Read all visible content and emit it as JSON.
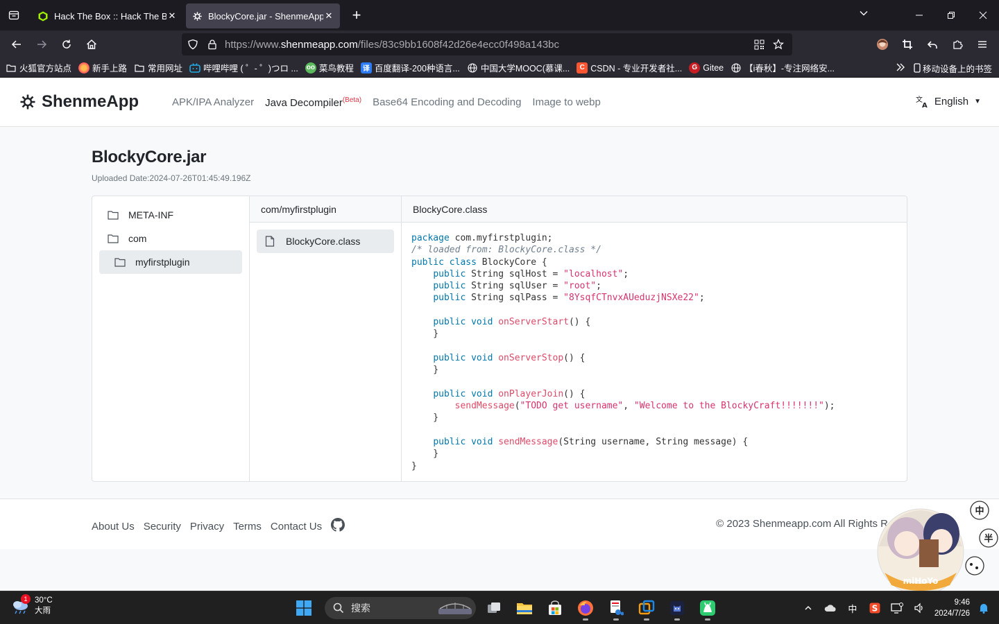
{
  "browser": {
    "tabs": [
      {
        "label": "Hack The Box :: Hack The Box",
        "active": false
      },
      {
        "label": "BlockyCore.jar - ShenmeApp",
        "active": true
      }
    ],
    "url_prefix": "https://www.",
    "url_domain": "shenmeapp.com",
    "url_path": "/files/83c9bb1608f42d26e4ecc0f498a143bc",
    "bookmarks": [
      {
        "label": "火狐官方站点",
        "icon": "folder-icon"
      },
      {
        "label": "新手上路",
        "icon": "firefox-icon"
      },
      {
        "label": "常用网址",
        "icon": "folder-icon"
      },
      {
        "label": "哔哩哔哩 ( ゜- ゜)つロ ...",
        "icon": "bilibili-icon"
      },
      {
        "label": "菜鸟教程",
        "icon": "runoob-icon"
      },
      {
        "label": "百度翻译-200种语言...",
        "icon": "translate-icon"
      },
      {
        "label": "中国大学MOOC(慕课...",
        "icon": "globe-icon"
      },
      {
        "label": "CSDN - 专业开发者社...",
        "icon": "csdn-icon"
      },
      {
        "label": "Gitee",
        "icon": "gitee-icon"
      },
      {
        "label": "【i春秋】-专注网络安...",
        "icon": "globe-icon"
      }
    ],
    "mobile_bookmarks": "移动设备上的书签"
  },
  "site": {
    "brand": "ShenmeApp",
    "nav": [
      {
        "label": "APK/IPA Analyzer",
        "active": false
      },
      {
        "label": "Java Decompiler",
        "badge": "(Beta)",
        "active": true
      },
      {
        "label": "Base64 Encoding and Decoding",
        "active": false
      },
      {
        "label": "Image to webp",
        "active": false
      }
    ],
    "language": "English"
  },
  "file": {
    "title": "BlockyCore.jar",
    "uploaded": "Uploaded Date:2024-07-26T01:45:49.196Z"
  },
  "explorer": {
    "tree": [
      {
        "label": "META-INF",
        "indent": false,
        "selected": false
      },
      {
        "label": "com",
        "indent": false,
        "selected": false
      },
      {
        "label": "myfirstplugin",
        "indent": true,
        "selected": true
      }
    ],
    "package_header": "com/myfirstplugin",
    "files": [
      "BlockyCore.class"
    ],
    "code_header": "BlockyCore.class",
    "code_lines": [
      [
        [
          "kw",
          "package"
        ],
        [
          "t",
          " com.myfirstplugin;"
        ]
      ],
      [
        [
          "cm",
          "/* loaded from: BlockyCore.class */"
        ]
      ],
      [
        [
          "kw",
          "public class"
        ],
        [
          "t",
          " BlockyCore {"
        ]
      ],
      [
        [
          "t",
          "    "
        ],
        [
          "kw",
          "public"
        ],
        [
          "t",
          " String sqlHost = "
        ],
        [
          "str",
          "\"localhost\""
        ],
        [
          "t",
          ";"
        ]
      ],
      [
        [
          "t",
          "    "
        ],
        [
          "kw",
          "public"
        ],
        [
          "t",
          " String sqlUser = "
        ],
        [
          "str",
          "\"root\""
        ],
        [
          "t",
          ";"
        ]
      ],
      [
        [
          "t",
          "    "
        ],
        [
          "kw",
          "public"
        ],
        [
          "t",
          " String sqlPass = "
        ],
        [
          "str",
          "\"8YsqfCTnvxAUeduzjNSXe22\""
        ],
        [
          "t",
          ";"
        ]
      ],
      [
        [
          "t",
          ""
        ]
      ],
      [
        [
          "t",
          "    "
        ],
        [
          "kw",
          "public void"
        ],
        [
          "t",
          " "
        ],
        [
          "fn",
          "onServerStart"
        ],
        [
          "t",
          "() {"
        ]
      ],
      [
        [
          "t",
          "    }"
        ]
      ],
      [
        [
          "t",
          ""
        ]
      ],
      [
        [
          "t",
          "    "
        ],
        [
          "kw",
          "public void"
        ],
        [
          "t",
          " "
        ],
        [
          "fn",
          "onServerStop"
        ],
        [
          "t",
          "() {"
        ]
      ],
      [
        [
          "t",
          "    }"
        ]
      ],
      [
        [
          "t",
          ""
        ]
      ],
      [
        [
          "t",
          "    "
        ],
        [
          "kw",
          "public void"
        ],
        [
          "t",
          " "
        ],
        [
          "fn",
          "onPlayerJoin"
        ],
        [
          "t",
          "() {"
        ]
      ],
      [
        [
          "t",
          "        "
        ],
        [
          "fn",
          "sendMessage"
        ],
        [
          "t",
          "("
        ],
        [
          "str",
          "\"TODO get username\""
        ],
        [
          "t",
          ", "
        ],
        [
          "str",
          "\"Welcome to the BlockyCraft!!!!!!!\""
        ],
        [
          "t",
          ");"
        ]
      ],
      [
        [
          "t",
          "    }"
        ]
      ],
      [
        [
          "t",
          ""
        ]
      ],
      [
        [
          "t",
          "    "
        ],
        [
          "kw",
          "public void"
        ],
        [
          "t",
          " "
        ],
        [
          "fn",
          "sendMessage"
        ],
        [
          "t",
          "(String username, String message) {"
        ]
      ],
      [
        [
          "t",
          "    }"
        ]
      ],
      [
        [
          "t",
          "}"
        ]
      ]
    ]
  },
  "footer": {
    "links": [
      "About Us",
      "Security",
      "Privacy",
      "Terms",
      "Contact Us"
    ],
    "copyright": "© 2023 Shenmeapp.com All Rights R"
  },
  "taskbar": {
    "weather_temp": "30°C",
    "weather_desc": "大雨",
    "weather_badge": "1",
    "search_placeholder": "搜索",
    "ime": "中",
    "time": "9:46",
    "date": "2024/7/26"
  },
  "colors": {
    "keyword": "#0077aa",
    "string": "#d6336c",
    "comment": "#708090"
  }
}
